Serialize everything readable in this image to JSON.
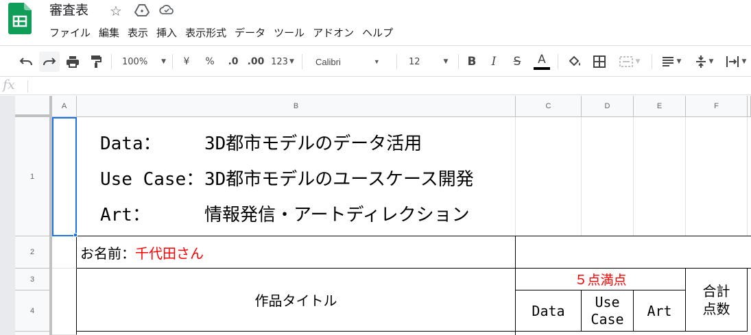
{
  "app": {
    "title": "審査表",
    "menu": [
      "ファイル",
      "編集",
      "表示",
      "挿入",
      "表示形式",
      "データ",
      "ツール",
      "アドオン",
      "ヘルプ"
    ]
  },
  "toolbar": {
    "zoom": "100%",
    "currency": "¥",
    "percent": "%",
    "dec_less": ".0",
    "dec_more": ".00",
    "number_format": "123",
    "font": "Calibri",
    "font_size": "12",
    "bold": "B",
    "italic": "I",
    "strike": "S",
    "text_color": "A",
    "text_color_value": "#000000"
  },
  "formula_bar": {
    "icon": "fx",
    "value": ""
  },
  "grid": {
    "columns": [
      "A",
      "B",
      "C",
      "D",
      "E",
      "F"
    ],
    "rows": [
      "1",
      "2",
      "3",
      "4"
    ],
    "b1_lines": [
      {
        "key": "Data：",
        "value": "3D都市モデルのデータ活用"
      },
      {
        "key": "Use Case：",
        "value": "3D都市モデルのユースケース開発"
      },
      {
        "key": "Art：",
        "value": "情報発信・アートディレクション"
      }
    ],
    "name_label": "お名前：",
    "name_value": "千代田さん",
    "score_header": "５点満点",
    "title_header": "作品タイトル",
    "col_data": "Data",
    "col_usecase_1": "Use",
    "col_usecase_2": "Case",
    "col_art": "Art",
    "total_1": "合計",
    "total_2": "点数",
    "accent_red": "#ff0000",
    "selection_color": "#1a73e8"
  }
}
